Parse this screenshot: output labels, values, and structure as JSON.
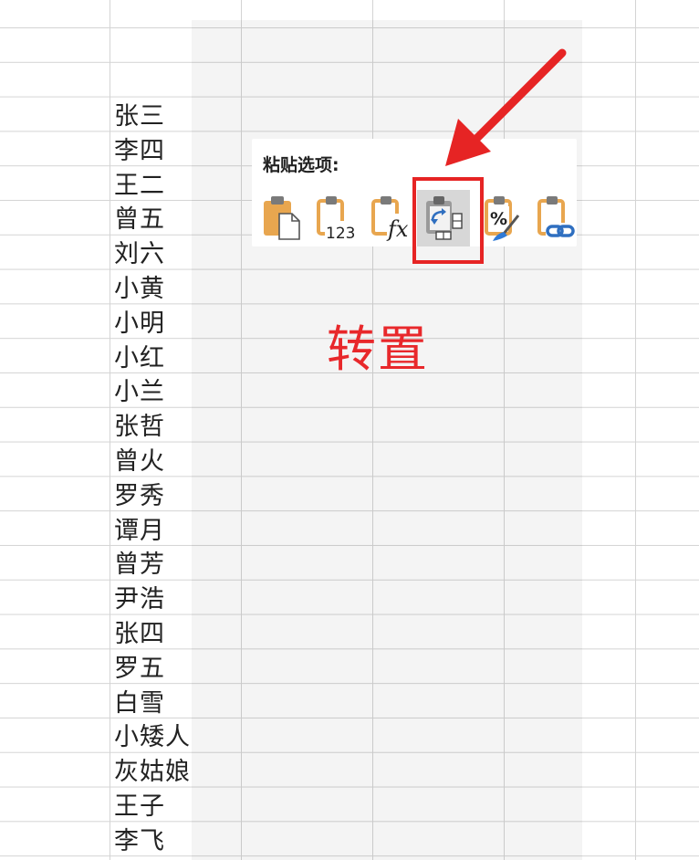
{
  "names": [
    "张三",
    "李四",
    "王二",
    "曾五",
    "刘六",
    "小黄",
    "小明",
    "小红",
    "小兰",
    "张哲",
    "曾火",
    "罗秀",
    "谭月",
    "曾芳",
    "尹浩",
    "张四",
    "罗五",
    "白雪",
    "小矮人",
    "灰姑娘",
    "王子",
    "李飞"
  ],
  "paste_menu": {
    "title": "粘贴选项:",
    "options": [
      {
        "icon": "paste-icon"
      },
      {
        "icon": "paste-values-icon",
        "text": "123"
      },
      {
        "icon": "paste-formulas-icon",
        "text": "fx"
      },
      {
        "icon": "transpose-icon",
        "selected": true
      },
      {
        "icon": "paste-formatting-icon",
        "text": "%"
      },
      {
        "icon": "paste-link-icon"
      }
    ]
  },
  "annotation": {
    "label": "转置",
    "color": "#e8282b"
  },
  "colors": {
    "clipboard": "#e8a64f",
    "accent": "#e62424",
    "grid": "#d4d4d4"
  }
}
